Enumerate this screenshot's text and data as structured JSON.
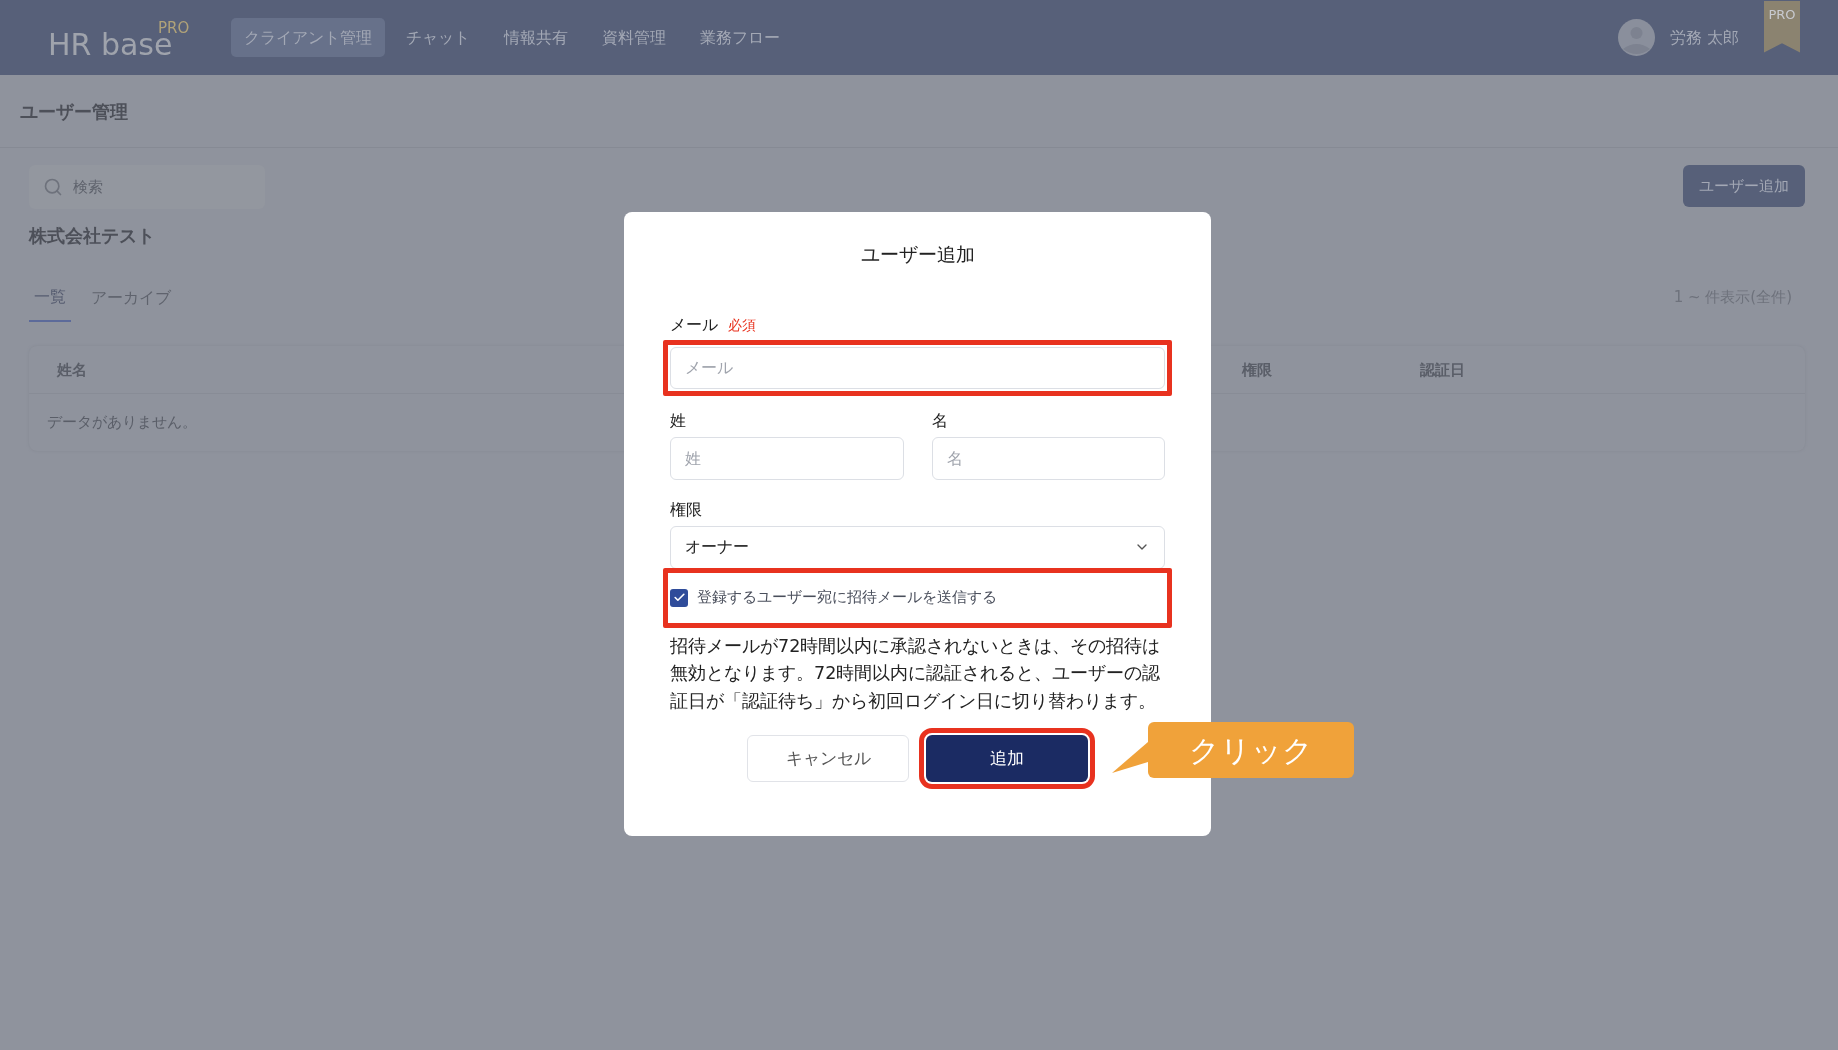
{
  "header": {
    "logo": {
      "text": "HR base",
      "badge": "PRO"
    },
    "nav": [
      {
        "label": "クライアント管理",
        "selected": true
      },
      {
        "label": "チャット",
        "selected": false
      },
      {
        "label": "情報共有",
        "selected": false
      },
      {
        "label": "資料管理",
        "selected": false
      },
      {
        "label": "業務フロー",
        "selected": false
      }
    ],
    "user_name": "労務 太郎",
    "plan_ribbon": "PRO"
  },
  "page": {
    "title": "ユーザー管理",
    "search": {
      "placeholder": "検索"
    },
    "add_button": "ユーザー追加",
    "company": "株式会社テスト",
    "tabs": [
      {
        "label": "一覧",
        "selected": true
      },
      {
        "label": "アーカイブ",
        "selected": false
      }
    ],
    "count": "1 ~ 件表示(全件)",
    "table": {
      "columns": [
        "姓名",
        "権限",
        "認証日"
      ],
      "empty_message": "データがありません。"
    }
  },
  "dialog": {
    "title": "ユーザー追加",
    "email": {
      "label": "メール",
      "required": "必須",
      "placeholder": "メール",
      "highlighted": true
    },
    "names": [
      {
        "label": "姓",
        "placeholder": "姓"
      },
      {
        "label": "名",
        "placeholder": "名"
      }
    ],
    "role": {
      "label": "権限",
      "value": "オーナー"
    },
    "invite": {
      "label": "登録するユーザー宛に招待メールを送信する",
      "checked": true,
      "highlighted": true
    },
    "note": "招待メールが72時間以内に承認されないときは、その招待は無効となります。72時間以内に認証されると、ユーザーの認証日が「認証待ち」から初回ログイン日に切り替わります。",
    "buttons": [
      {
        "label": "キャンセル",
        "kind": "secondary",
        "highlighted": false
      },
      {
        "label": "追加",
        "kind": "primary",
        "highlighted": true
      }
    ]
  },
  "callout": {
    "text": "クリック"
  }
}
